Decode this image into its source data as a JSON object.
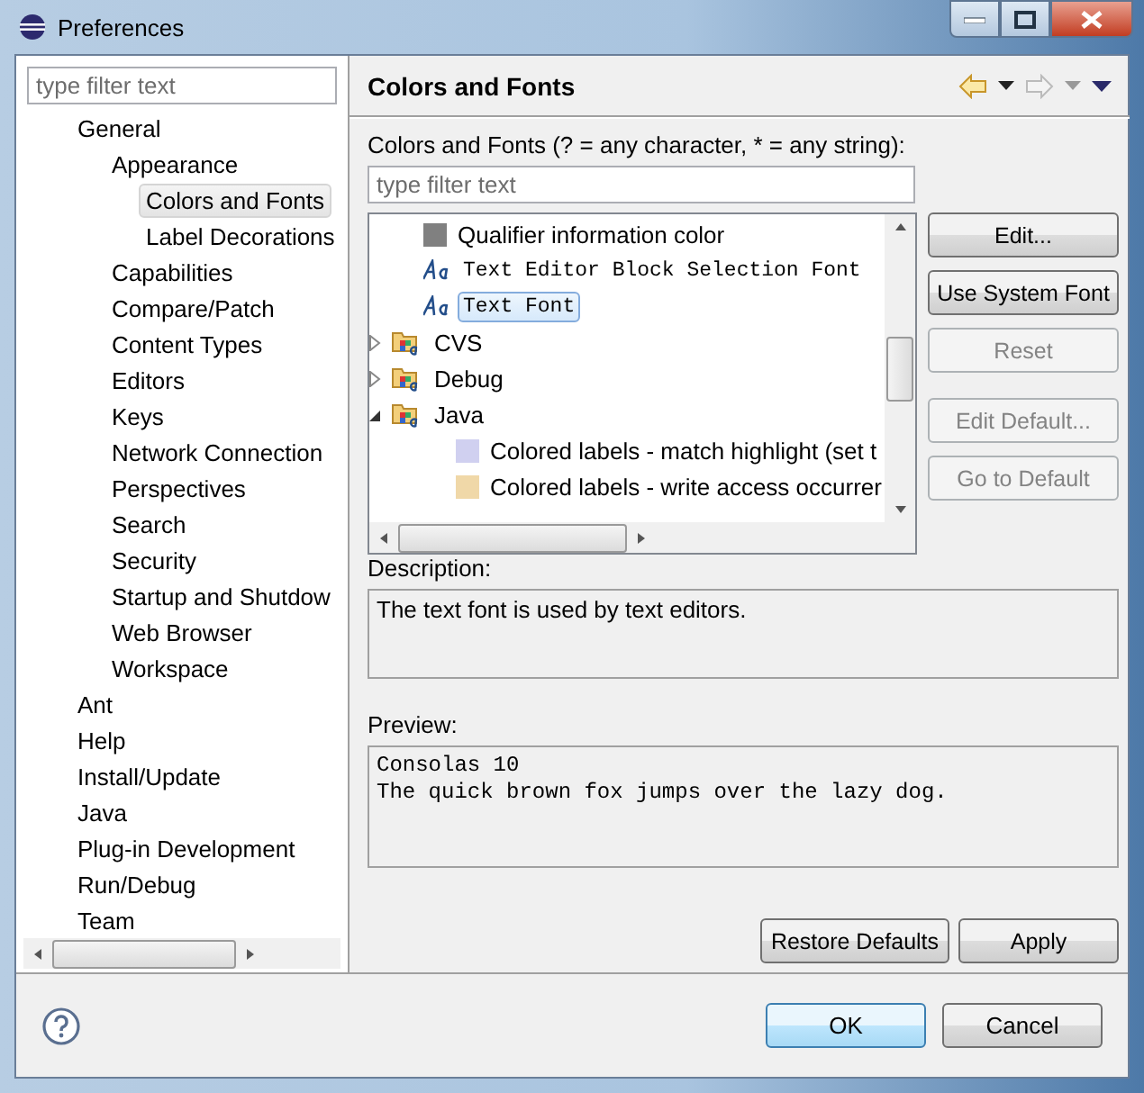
{
  "window": {
    "title": "Preferences"
  },
  "sidebar": {
    "filter_placeholder": "type filter text",
    "items": [
      {
        "label": "General",
        "selected": false,
        "children": [
          {
            "label": "Appearance",
            "selected": false,
            "children": [
              {
                "label": "Colors and Fonts",
                "selected": true
              },
              {
                "label": "Label Decorations",
                "selected": false
              }
            ]
          },
          {
            "label": "Capabilities",
            "selected": false
          },
          {
            "label": "Compare/Patch",
            "selected": false
          },
          {
            "label": "Content Types",
            "selected": false
          },
          {
            "label": "Editors",
            "selected": false
          },
          {
            "label": "Keys",
            "selected": false
          },
          {
            "label": "Network Connection",
            "selected": false
          },
          {
            "label": "Perspectives",
            "selected": false
          },
          {
            "label": "Search",
            "selected": false
          },
          {
            "label": "Security",
            "selected": false
          },
          {
            "label": "Startup and Shutdow",
            "selected": false
          },
          {
            "label": "Web Browser",
            "selected": false
          },
          {
            "label": "Workspace",
            "selected": false
          }
        ]
      },
      {
        "label": "Ant",
        "selected": false
      },
      {
        "label": "Help",
        "selected": false
      },
      {
        "label": "Install/Update",
        "selected": false
      },
      {
        "label": "Java",
        "selected": false
      },
      {
        "label": "Plug-in Development",
        "selected": false
      },
      {
        "label": "Run/Debug",
        "selected": false
      },
      {
        "label": "Team",
        "selected": false
      }
    ]
  },
  "page": {
    "title": "Colors and Fonts",
    "intro": "Colors and Fonts (? = any character, * = any string):",
    "filter_placeholder": "type filter text",
    "tree": [
      {
        "kind": "color",
        "label": "Qualifier information color",
        "color": "#808080",
        "selected": false
      },
      {
        "kind": "font",
        "label": "Text Editor Block Selection Font",
        "selected": false
      },
      {
        "kind": "font",
        "label": "Text Font",
        "selected": true
      },
      {
        "kind": "category",
        "label": "CVS",
        "expanded": false,
        "selected": false
      },
      {
        "kind": "category",
        "label": "Debug",
        "expanded": false,
        "selected": false
      },
      {
        "kind": "category",
        "label": "Java",
        "expanded": true,
        "selected": false,
        "children": [
          {
            "kind": "color",
            "label": "Colored labels - match highlight (set t",
            "color": "#d0d0f0",
            "selected": false
          },
          {
            "kind": "color",
            "label": "Colored labels - write access occurrer",
            "color": "#f0d8a8",
            "selected": false
          }
        ]
      }
    ],
    "buttons": [
      {
        "label": "Edit...",
        "disabled": false
      },
      {
        "label": "Use System Font",
        "disabled": false
      },
      {
        "label": "Reset",
        "disabled": true
      },
      {
        "label": "Edit Default...",
        "disabled": true
      },
      {
        "label": "Go to Default",
        "disabled": true
      }
    ],
    "description_label": "Description:",
    "description": "The text font is used by text editors.",
    "preview_label": "Preview:",
    "preview": [
      "Consolas 10",
      "The quick brown fox jumps over the lazy dog."
    ],
    "page_buttons": [
      "Restore Defaults",
      "Apply"
    ]
  },
  "footer": {
    "buttons": [
      {
        "label": "OK",
        "default": true
      },
      {
        "label": "Cancel",
        "default": false
      }
    ]
  }
}
